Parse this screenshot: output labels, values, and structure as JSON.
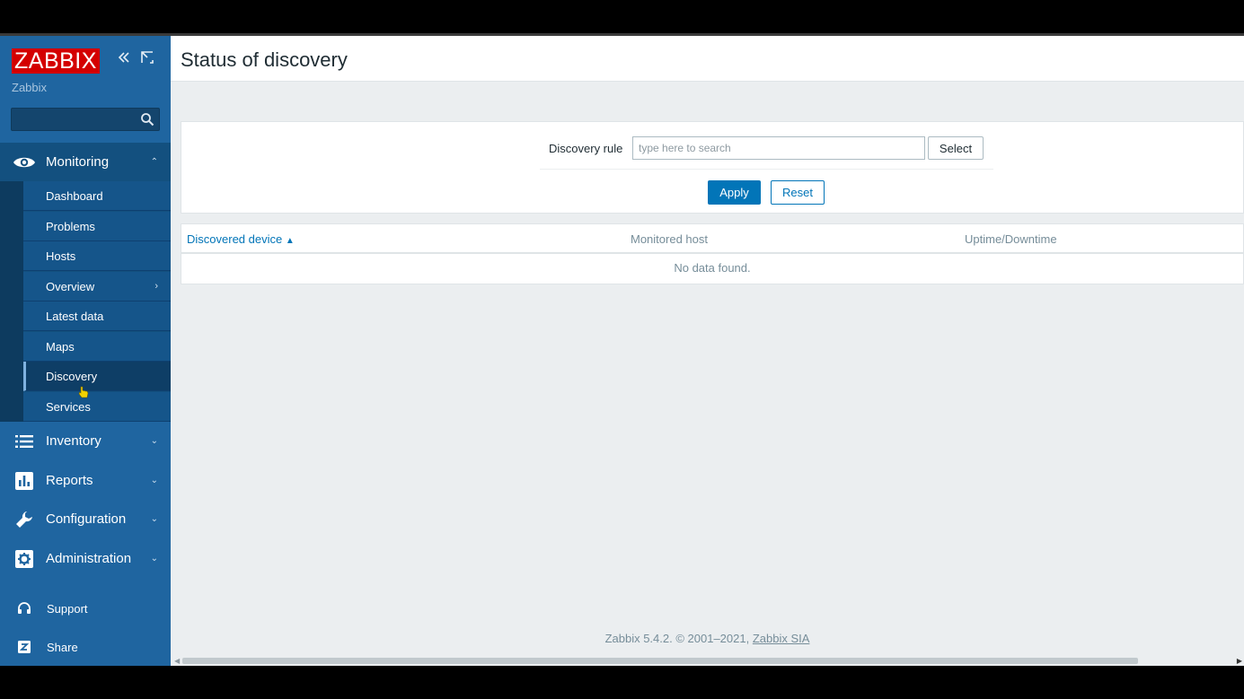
{
  "sidebar": {
    "logo": "ZABBIX",
    "server_name": "Zabbix",
    "search": {
      "value": "",
      "placeholder": ""
    },
    "sections": {
      "monitoring": "Monitoring",
      "inventory": "Inventory",
      "reports": "Reports",
      "configuration": "Configuration",
      "administration": "Administration"
    },
    "monitoring_items": [
      "Dashboard",
      "Problems",
      "Hosts",
      "Overview",
      "Latest data",
      "Maps",
      "Discovery",
      "Services"
    ],
    "active_item": "Discovery",
    "bottom": {
      "support": "Support",
      "share": "Share"
    }
  },
  "header": {
    "title": "Status of discovery"
  },
  "filter": {
    "label": "Discovery rule",
    "input_value": "",
    "input_placeholder": "type here to search",
    "select_label": "Select",
    "apply_label": "Apply",
    "reset_label": "Reset"
  },
  "table": {
    "columns": [
      "Discovered device",
      "Monitored host",
      "Uptime/Downtime"
    ],
    "sort_column": "Discovered device",
    "sort_indicator": "▲",
    "empty_text": "No data found."
  },
  "footer": {
    "text": "Zabbix 5.4.2. © 2001–2021,",
    "link": "Zabbix SIA"
  },
  "colors": {
    "sidebar": "#1f65a0",
    "accent": "#0275b8",
    "logo": "#d40000"
  }
}
